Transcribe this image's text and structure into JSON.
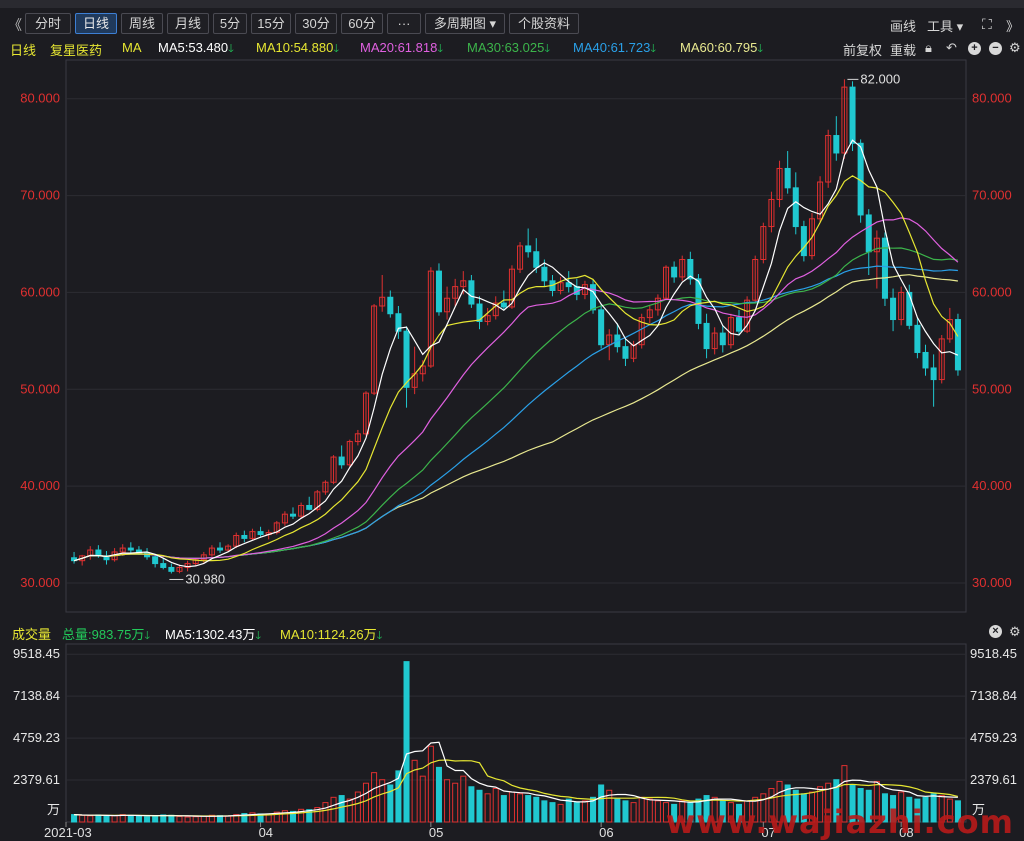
{
  "toolbar": {
    "collapse": "《",
    "buttons": [
      "分时",
      "日线",
      "周线",
      "月线",
      "5分",
      "15分",
      "30分",
      "60分",
      "···",
      "多周期图 ▾",
      "个股资料"
    ],
    "active": "日线",
    "draw_label": "画线",
    "tools_label": "工具 ▾",
    "expand_label": "⛶",
    "more_label": "》"
  },
  "ma_legend": {
    "period": "日线",
    "stock_name": "复星医药",
    "ma_label": "MA",
    "ma5": "MA5:53.480",
    "ma10": "MA10:54.880",
    "ma20": "MA20:61.818",
    "ma30": "MA30:63.025",
    "ma40": "MA40:61.723",
    "ma60": "MA60:60.795",
    "adjust": "前复权",
    "reload": "重载"
  },
  "colors": {
    "ma5": "#ffffff",
    "ma10": "#e6e632",
    "ma20": "#e060e0",
    "ma30": "#3cb44b",
    "ma40": "#2aa0e8",
    "ma60": "#e8e890",
    "up": "#e03030",
    "down": "#20c8d0",
    "axis_text": "#e03030",
    "grid": "#2d2d33"
  },
  "price_axis": {
    "ticks": [
      "80.000",
      "70.000",
      "60.000",
      "50.000",
      "40.000",
      "30.000"
    ],
    "values": [
      80,
      70,
      60,
      50,
      40,
      30
    ],
    "min": 27.0,
    "max": 84.0
  },
  "annotations": {
    "high": "82.000",
    "low": "30.980"
  },
  "volume": {
    "title": "成交量",
    "total": "总量:983.75万",
    "ma5": "MA5:1302.43万",
    "ma10": "MA10:1124.26万",
    "ticks": [
      "9518.45",
      "7138.84",
      "4759.23",
      "2379.61"
    ],
    "tick_values": [
      9518.45,
      7138.84,
      4759.23,
      2379.61
    ],
    "unit": "万",
    "max": 10100
  },
  "x_axis": {
    "labels": [
      "2021-03",
      "04",
      "05",
      "06",
      "07",
      "08"
    ]
  },
  "watermark": "www.wajiazhi.com",
  "chart_data": {
    "type": "candlestick",
    "title": "复星医药 日线",
    "candles": [
      [
        32.6,
        33.2,
        32.0,
        32.3
      ],
      [
        32.3,
        32.9,
        31.8,
        32.8
      ],
      [
        32.8,
        33.8,
        32.4,
        33.4
      ],
      [
        33.4,
        33.9,
        32.6,
        32.8
      ],
      [
        32.8,
        33.3,
        31.9,
        32.4
      ],
      [
        32.4,
        33.6,
        32.2,
        33.2
      ],
      [
        33.2,
        34.0,
        32.8,
        33.6
      ],
      [
        33.6,
        34.2,
        33.0,
        33.4
      ],
      [
        33.4,
        33.8,
        32.9,
        33.1
      ],
      [
        33.1,
        33.6,
        32.4,
        32.7
      ],
      [
        32.7,
        33.0,
        31.6,
        32.0
      ],
      [
        32.0,
        32.6,
        31.4,
        31.6
      ],
      [
        31.6,
        32.0,
        30.98,
        31.2
      ],
      [
        31.2,
        31.9,
        31.0,
        31.6
      ],
      [
        31.6,
        32.3,
        31.2,
        32.0
      ],
      [
        32.0,
        32.6,
        31.7,
        32.4
      ],
      [
        32.4,
        33.2,
        32.1,
        32.9
      ],
      [
        32.9,
        33.9,
        32.7,
        33.6
      ],
      [
        33.6,
        34.2,
        33.1,
        33.4
      ],
      [
        33.4,
        34.0,
        33.2,
        33.8
      ],
      [
        33.8,
        35.2,
        33.6,
        34.9
      ],
      [
        34.9,
        35.4,
        34.2,
        34.6
      ],
      [
        34.6,
        35.6,
        34.4,
        35.3
      ],
      [
        35.3,
        35.8,
        34.8,
        35.0
      ],
      [
        35.0,
        35.5,
        34.5,
        35.2
      ],
      [
        35.2,
        36.4,
        35.0,
        36.2
      ],
      [
        36.2,
        37.4,
        35.9,
        37.1
      ],
      [
        37.1,
        37.8,
        36.6,
        36.9
      ],
      [
        36.9,
        38.3,
        36.7,
        38.0
      ],
      [
        38.0,
        38.9,
        37.5,
        37.6
      ],
      [
        37.6,
        39.6,
        37.4,
        39.4
      ],
      [
        39.4,
        40.6,
        39.1,
        40.4
      ],
      [
        40.4,
        43.2,
        40.2,
        43.0
      ],
      [
        43.0,
        44.2,
        41.8,
        42.2
      ],
      [
        42.2,
        44.8,
        42.0,
        44.6
      ],
      [
        44.6,
        45.8,
        44.2,
        45.4
      ],
      [
        45.4,
        49.8,
        45.2,
        49.6
      ],
      [
        49.6,
        58.8,
        49.4,
        58.6
      ],
      [
        58.6,
        61.8,
        58.0,
        59.5
      ],
      [
        59.5,
        60.2,
        57.4,
        57.8
      ],
      [
        57.8,
        58.6,
        55.2,
        56.0
      ],
      [
        56.0,
        56.5,
        48.1,
        50.2
      ],
      [
        50.2,
        54.4,
        49.5,
        51.6
      ],
      [
        51.6,
        53.0,
        50.8,
        52.4
      ],
      [
        52.4,
        62.6,
        52.2,
        62.2
      ],
      [
        62.2,
        63.0,
        57.6,
        58.0
      ],
      [
        58.0,
        60.6,
        57.2,
        59.4
      ],
      [
        59.4,
        61.4,
        58.6,
        60.6
      ],
      [
        60.6,
        62.2,
        59.8,
        61.2
      ],
      [
        61.2,
        61.8,
        58.4,
        58.8
      ],
      [
        58.8,
        59.6,
        56.2,
        57.0
      ],
      [
        57.0,
        58.4,
        56.6,
        57.6
      ],
      [
        57.6,
        59.6,
        57.2,
        58.9
      ],
      [
        58.9,
        60.2,
        58.2,
        58.5
      ],
      [
        58.5,
        62.8,
        58.3,
        62.4
      ],
      [
        62.4,
        65.2,
        62.0,
        64.8
      ],
      [
        64.8,
        66.6,
        63.6,
        64.2
      ],
      [
        64.2,
        65.6,
        62.0,
        62.6
      ],
      [
        62.6,
        63.4,
        60.6,
        61.2
      ],
      [
        61.2,
        61.8,
        59.6,
        60.2
      ],
      [
        60.2,
        61.6,
        59.8,
        61.0
      ],
      [
        61.0,
        62.2,
        60.0,
        60.6
      ],
      [
        60.6,
        61.4,
        59.2,
        59.8
      ],
      [
        59.8,
        61.2,
        59.3,
        60.8
      ],
      [
        60.8,
        61.4,
        57.8,
        58.2
      ],
      [
        58.2,
        58.8,
        54.2,
        54.6
      ],
      [
        54.6,
        56.2,
        53.0,
        55.6
      ],
      [
        55.6,
        56.8,
        53.8,
        54.4
      ],
      [
        54.4,
        55.2,
        52.4,
        53.2
      ],
      [
        53.2,
        55.0,
        52.8,
        54.6
      ],
      [
        54.6,
        57.8,
        54.2,
        57.4
      ],
      [
        57.4,
        58.6,
        56.8,
        58.2
      ],
      [
        58.2,
        59.8,
        57.6,
        59.4
      ],
      [
        59.4,
        62.8,
        59.2,
        62.6
      ],
      [
        62.6,
        63.2,
        61.0,
        61.6
      ],
      [
        61.6,
        63.8,
        61.2,
        63.4
      ],
      [
        63.4,
        64.2,
        60.8,
        61.4
      ],
      [
        61.4,
        61.9,
        56.2,
        56.8
      ],
      [
        56.8,
        57.8,
        53.2,
        54.2
      ],
      [
        54.2,
        56.4,
        53.6,
        55.8
      ],
      [
        55.8,
        56.6,
        53.8,
        54.6
      ],
      [
        54.6,
        57.8,
        54.2,
        57.4
      ],
      [
        57.4,
        58.2,
        55.6,
        56.0
      ],
      [
        56.0,
        59.6,
        55.8,
        59.2
      ],
      [
        59.2,
        63.8,
        59.0,
        63.4
      ],
      [
        63.4,
        67.2,
        63.0,
        66.8
      ],
      [
        66.8,
        70.4,
        66.2,
        69.6
      ],
      [
        69.6,
        73.6,
        68.8,
        72.8
      ],
      [
        72.8,
        74.6,
        70.2,
        70.8
      ],
      [
        70.8,
        72.4,
        66.0,
        66.8
      ],
      [
        66.8,
        67.4,
        63.2,
        63.8
      ],
      [
        63.8,
        68.2,
        63.4,
        67.6
      ],
      [
        67.6,
        72.0,
        67.2,
        71.4
      ],
      [
        71.4,
        76.8,
        70.8,
        76.2
      ],
      [
        76.2,
        78.2,
        73.6,
        74.4
      ],
      [
        74.4,
        82.0,
        73.8,
        81.2
      ],
      [
        81.2,
        81.8,
        74.6,
        75.4
      ],
      [
        75.4,
        75.8,
        67.2,
        68.0
      ],
      [
        68.0,
        68.6,
        61.8,
        64.2
      ],
      [
        64.2,
        66.4,
        60.4,
        65.6
      ],
      [
        65.6,
        66.2,
        58.6,
        59.4
      ],
      [
        59.4,
        60.4,
        56.0,
        57.2
      ],
      [
        57.2,
        60.6,
        56.6,
        60.0
      ],
      [
        60.0,
        60.8,
        56.2,
        56.6
      ],
      [
        56.6,
        57.4,
        53.2,
        53.8
      ],
      [
        53.8,
        54.6,
        51.4,
        52.2
      ],
      [
        52.2,
        53.6,
        48.2,
        51.0
      ],
      [
        51.0,
        55.6,
        50.6,
        55.2
      ],
      [
        55.2,
        58.4,
        54.8,
        57.2
      ],
      [
        57.2,
        57.8,
        51.4,
        52.0
      ]
    ],
    "volumes": [
      420,
      380,
      350,
      400,
      330,
      360,
      420,
      380,
      340,
      300,
      360,
      400,
      380,
      310,
      280,
      300,
      340,
      380,
      360,
      330,
      420,
      480,
      520,
      460,
      440,
      560,
      640,
      600,
      720,
      700,
      820,
      1100,
      1400,
      1500,
      1300,
      1700,
      2200,
      2800,
      2400,
      2100,
      2900,
      9100,
      3500,
      2600,
      4300,
      3100,
      2400,
      2200,
      2600,
      2000,
      1800,
      1600,
      1900,
      1500,
      1700,
      1600,
      1500,
      1400,
      1200,
      1100,
      1000,
      1300,
      1100,
      1200,
      1400,
      2100,
      1800,
      1300,
      1200,
      1100,
      1400,
      1300,
      1200,
      1100,
      1000,
      1200,
      1100,
      1300,
      1500,
      1400,
      1200,
      1100,
      1000,
      1200,
      1400,
      1600,
      1900,
      2300,
      2100,
      1800,
      1600,
      1700,
      2000,
      2200,
      2400,
      3200,
      2100,
      1900,
      1800,
      2300,
      1600,
      1500,
      1700,
      1400,
      1300,
      1400,
      1600,
      1500,
      1300,
      1200
    ],
    "price_axis_ylim": [
      27,
      84
    ],
    "volume_unit": "万"
  }
}
